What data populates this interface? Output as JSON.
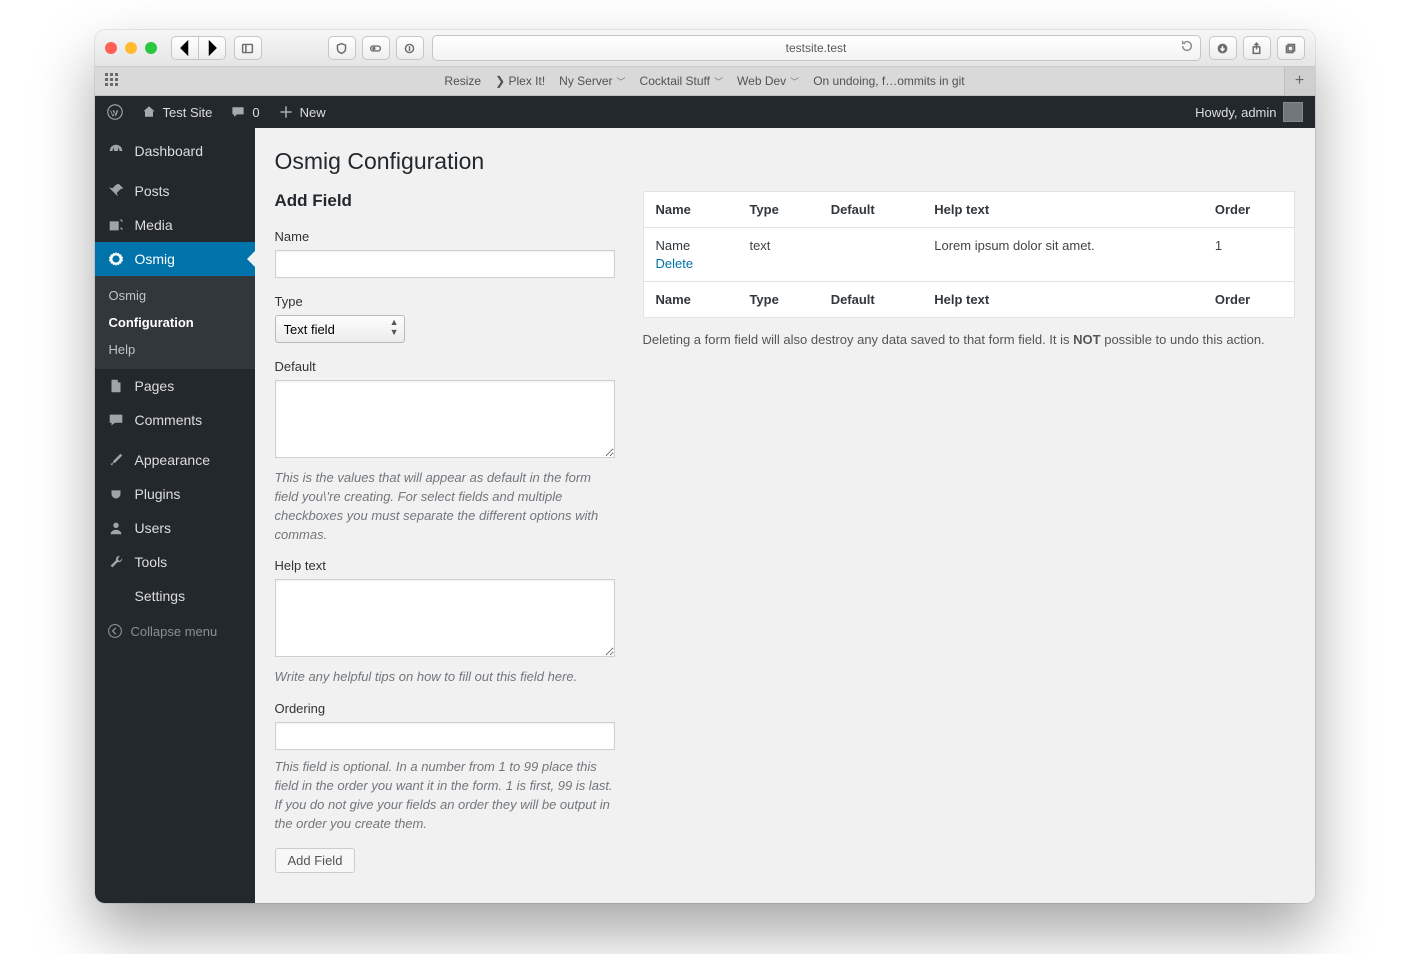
{
  "browser": {
    "url_display": "testsite.test",
    "favorites": [
      "Resize",
      "❯ Plex It!",
      "Ny Server",
      "Cocktail Stuff",
      "Web Dev",
      "On undoing, f…ommits in git"
    ],
    "fav_has_menu": [
      false,
      false,
      true,
      true,
      true,
      false
    ]
  },
  "adminbar": {
    "site_name": "Test Site",
    "comments_count": "0",
    "new_label": "New",
    "howdy": "Howdy, admin"
  },
  "sidebar": {
    "items": [
      {
        "label": "Dashboard"
      },
      {
        "label": "Posts"
      },
      {
        "label": "Media"
      },
      {
        "label": "Osmig"
      },
      {
        "label": "Pages"
      },
      {
        "label": "Comments"
      },
      {
        "label": "Appearance"
      },
      {
        "label": "Plugins"
      },
      {
        "label": "Users"
      },
      {
        "label": "Tools"
      },
      {
        "label": "Settings"
      }
    ],
    "submenu": [
      "Osmig",
      "Configuration",
      "Help"
    ],
    "submenu_active_index": 1,
    "collapse": "Collapse menu"
  },
  "page": {
    "title": "Osmig Configuration",
    "form": {
      "heading": "Add Field",
      "name_label": "Name",
      "name_value": "",
      "type_label": "Type",
      "type_value": "Text field",
      "default_label": "Default",
      "default_value": "",
      "default_hint": "This is the values that will appear as default in the form field you\\'re creating. For select fields and multiple checkboxes you must separate the different options with commas.",
      "help_label": "Help text",
      "help_value": "",
      "help_hint": "Write any helpful tips on how to fill out this field here.",
      "order_label": "Ordering",
      "order_value": "",
      "order_hint": "This field is optional. In a number from 1 to 99 place this field in the order you want it in the form. 1 is first, 99 is last. If you do not give your fields an order they will be output in the order you create them.",
      "submit_label": "Add Field"
    },
    "table": {
      "columns": [
        "Name",
        "Type",
        "Default",
        "Help text",
        "Order"
      ],
      "rows": [
        {
          "name": "Name",
          "action": "Delete",
          "type": "text",
          "default": "",
          "help": "Lorem ipsum dolor sit amet.",
          "order": "1"
        }
      ],
      "delete_note_pre": "Deleting a form field will also destroy any data saved to that form field. It is ",
      "delete_note_strong": "NOT",
      "delete_note_post": " possible to undo this action."
    }
  }
}
